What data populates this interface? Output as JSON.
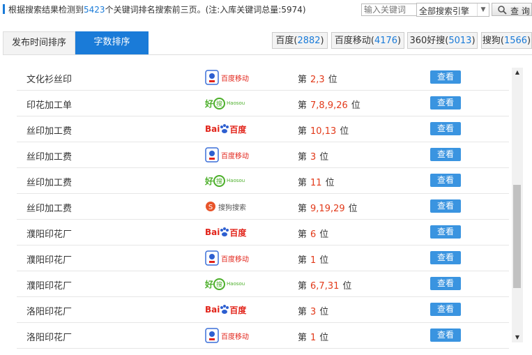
{
  "header": {
    "summary_prefix": "根据搜索结果检测到",
    "summary_count": "5423",
    "summary_suffix": "个关键词排名搜索前三页。(注:入库关键词总量:5974)",
    "keyword_placeholder": "输入关键词",
    "engine_select_value": "全部搜索引擎",
    "query_button": "查 询"
  },
  "tabs": [
    {
      "label": "发布时间排序",
      "active": false
    },
    {
      "label": "字数排序",
      "active": true
    }
  ],
  "engine_tabs": [
    {
      "name": "百度",
      "count": "2882"
    },
    {
      "name": "百度移动",
      "count": "4176"
    },
    {
      "name": "360好搜",
      "count": "5013"
    },
    {
      "name": "搜狗",
      "count": "1566"
    }
  ],
  "rank_prefix": "第",
  "rank_suffix": "位",
  "view_label": "查看",
  "logo_text": {
    "baidu_mobile": "百度移动",
    "haosou_cn": "好",
    "haosou_cn2": "搜",
    "haosou_en": "Haosou",
    "baidu_en": "Bai",
    "baidu_cn": "百度",
    "sogou": "搜狗搜索"
  },
  "rows": [
    {
      "keyword": "文化衫丝印",
      "engine": "baidu_mobile",
      "positions": "2,3"
    },
    {
      "keyword": "印花加工单",
      "engine": "haosou",
      "positions": "7,8,9,26"
    },
    {
      "keyword": "丝印加工费",
      "engine": "baidu",
      "positions": "10,13"
    },
    {
      "keyword": "丝印加工费",
      "engine": "baidu_mobile",
      "positions": "3"
    },
    {
      "keyword": "丝印加工费",
      "engine": "haosou",
      "positions": "11"
    },
    {
      "keyword": "丝印加工费",
      "engine": "sogou",
      "positions": "9,19,29"
    },
    {
      "keyword": "濮阳印花厂",
      "engine": "baidu",
      "positions": "6"
    },
    {
      "keyword": "濮阳印花厂",
      "engine": "baidu_mobile",
      "positions": "1"
    },
    {
      "keyword": "濮阳印花厂",
      "engine": "haosou",
      "positions": "6,7,31"
    },
    {
      "keyword": "洛阳印花厂",
      "engine": "baidu",
      "positions": "3"
    },
    {
      "keyword": "洛阳印花厂",
      "engine": "baidu_mobile",
      "positions": "1"
    }
  ],
  "colors": {
    "accent": "#1a7bd8",
    "rank": "#e23a1a",
    "button": "#3a94e0"
  }
}
